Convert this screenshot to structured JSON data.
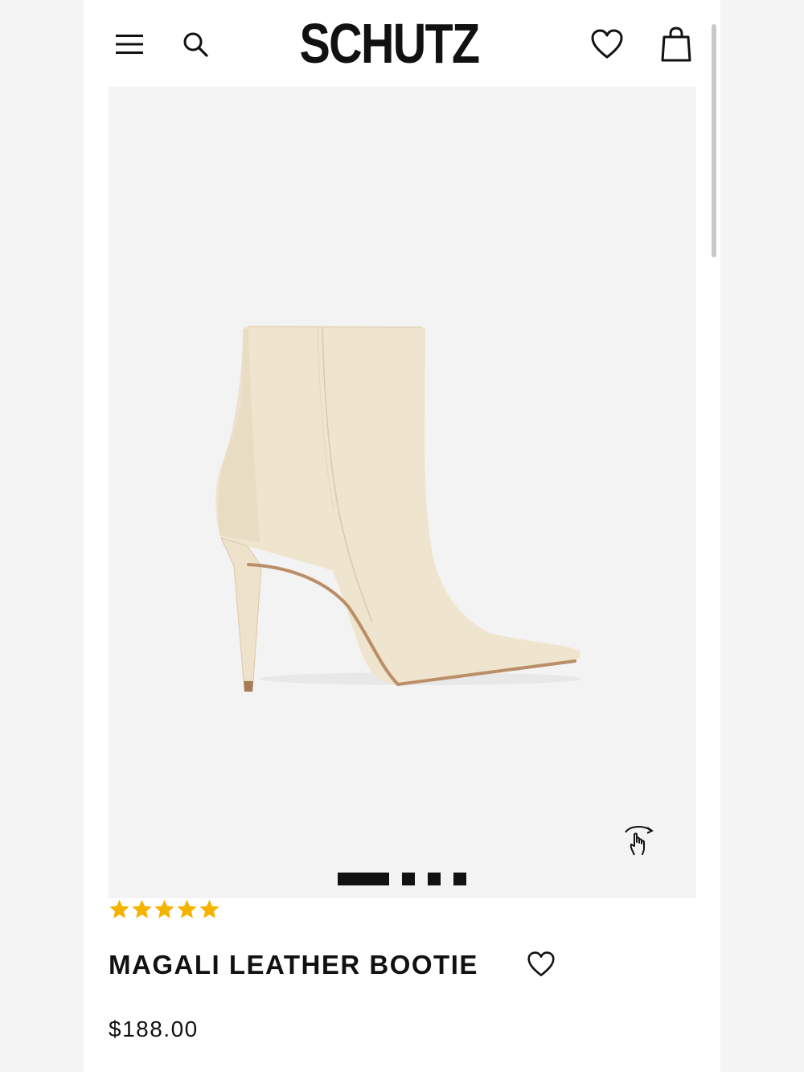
{
  "brand": {
    "logo": "SCHUTZ"
  },
  "header": {
    "menu_icon": "hamburger-menu-icon",
    "search_icon": "search-icon",
    "wishlist_icon": "heart-icon",
    "bag_icon": "shopping-bag-icon"
  },
  "gallery": {
    "image": "cream-leather-ankle-bootie",
    "rotate_icon": "hand-rotate-360-icon",
    "slide_count": 4,
    "active_slide": 1
  },
  "product": {
    "rating": 5,
    "rating_max": 5,
    "name": "MAGALI LEATHER BOOTIE",
    "price": "$188.00"
  },
  "colors": {
    "star": "#f5b301",
    "text": "#111111",
    "gallery_bg": "#f3f3f3",
    "boot": "#efe4cd"
  }
}
